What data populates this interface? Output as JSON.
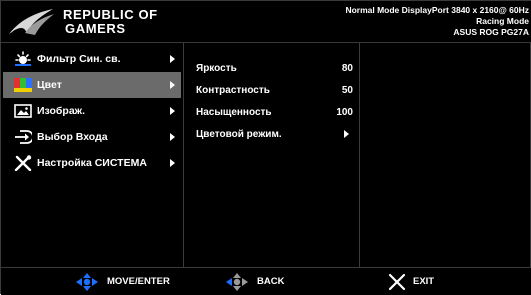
{
  "header": {
    "brand_line1": "REPUBLIC OF",
    "brand_line2": "GAMERS",
    "status_line1": "Normal Mode DisplayPort 3840 x 2160@ 60Hz",
    "status_line2": "Racing Mode",
    "status_line3": "ASUS ROG PG27A",
    "logo_icon": "rog-eye-logo"
  },
  "main_menu": {
    "items": [
      {
        "label": "Фильтр Син. св.",
        "icon": "blue-light-filter-icon",
        "selected": false
      },
      {
        "label": "Цвет",
        "icon": "color-palette-icon",
        "selected": true
      },
      {
        "label": "Изображ.",
        "icon": "image-icon",
        "selected": false
      },
      {
        "label": "Выбор Входа",
        "icon": "input-select-icon",
        "selected": false
      },
      {
        "label": "Настройка СИСТЕМА",
        "icon": "system-tools-icon",
        "selected": false
      }
    ]
  },
  "sub_menu": {
    "items": [
      {
        "label": "Яркость",
        "value": "80"
      },
      {
        "label": "Контрастность",
        "value": "50"
      },
      {
        "label": "Насыщенность",
        "value": "100"
      },
      {
        "label": "Цветовой режим.",
        "value": ""
      }
    ]
  },
  "footer": {
    "move_label": "MOVE/ENTER",
    "back_label": "BACK",
    "exit_label": "EXIT"
  },
  "colors": {
    "accent_blue": "#1e6fff",
    "selected_bg": "#6b6b6b",
    "divider": "#3a3a3a"
  }
}
